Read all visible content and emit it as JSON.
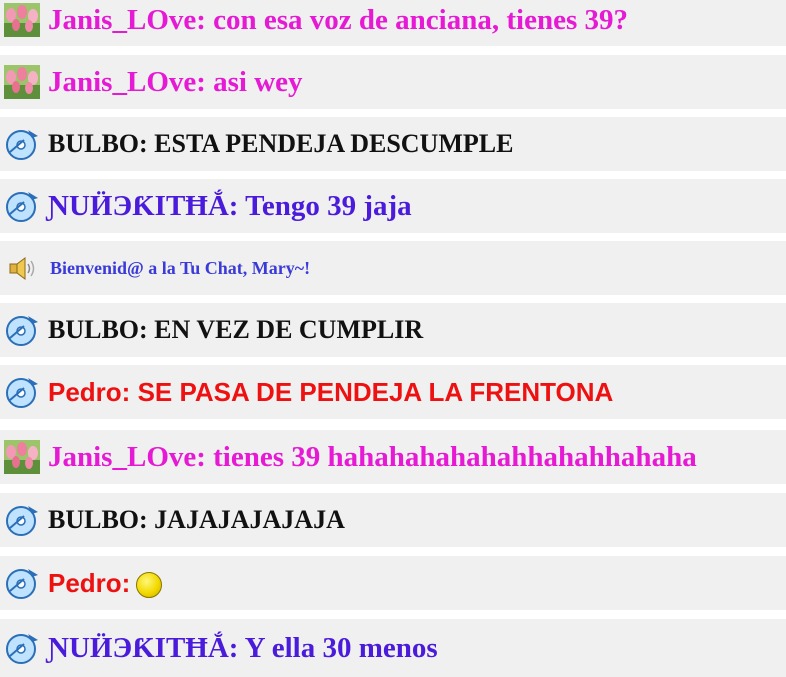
{
  "messages": [
    {
      "kind": "tulip",
      "user": "Janis_LOve",
      "text": "con esa voz de anciana, tienes 39?"
    },
    {
      "kind": "tulip",
      "user": "Janis_LOve",
      "text": "asi wey"
    },
    {
      "kind": "disc",
      "user": "BULBO",
      "text": "ESTA PENDEJA DESCUMPLE"
    },
    {
      "kind": "disc",
      "user": "ƝUӤЭƘITĦẮ",
      "text": "Tengo 39 jaja"
    },
    {
      "kind": "speaker",
      "text": "Bienvenid@ a la Tu Chat, Mary~!"
    },
    {
      "kind": "disc",
      "user": "BULBO",
      "text": "EN VEZ DE CUMPLIR"
    },
    {
      "kind": "disc",
      "user": "Pedro",
      "text": "SE PASA DE PENDEJA LA FRENTONA"
    },
    {
      "kind": "tulip",
      "user": "Janis_LOve",
      "text": "tienes 39 hahahahahahahhahahhahaha"
    },
    {
      "kind": "disc",
      "user": "BULBO",
      "text": "JAJAJAJAJAJA"
    },
    {
      "kind": "disc",
      "user": "Pedro",
      "text": "",
      "emoji": "yellow-smiley"
    },
    {
      "kind": "disc",
      "user": "ƝUӤЭƘITĦẮ",
      "text": "Y ella 30 menos"
    }
  ],
  "display": {
    "m0": "Janis_LOve: con esa voz de anciana, tienes 39?",
    "m1": "Janis_LOve: asi wey",
    "m2": "BULBO: ESTA PENDEJA DESCUMPLE",
    "m3": "ƝUӤЭƘITĦẮ: Tengo 39 jaja",
    "m4": "Bienvenid@ a la Tu Chat, Mary~!",
    "m5": "BULBO: EN VEZ DE CUMPLIR",
    "m6": "Pedro: SE PASA DE PENDEJA LA FRENTONA",
    "m7": "Janis_LOve: tienes 39 hahahahahahahhahahhahaha",
    "m8": "BULBO: JAJAJAJAJAJA",
    "m9": "Pedro:",
    "m10": "ƝUӤЭƘITĦẮ: Y ella 30 menos"
  },
  "colors": {
    "janis": "#e619d4",
    "bulbo": "#111111",
    "muneca": "#4a1bdb",
    "system": "#3a3ad8",
    "pedro": "#ee1111",
    "row_bg": "#f0f0f0"
  }
}
